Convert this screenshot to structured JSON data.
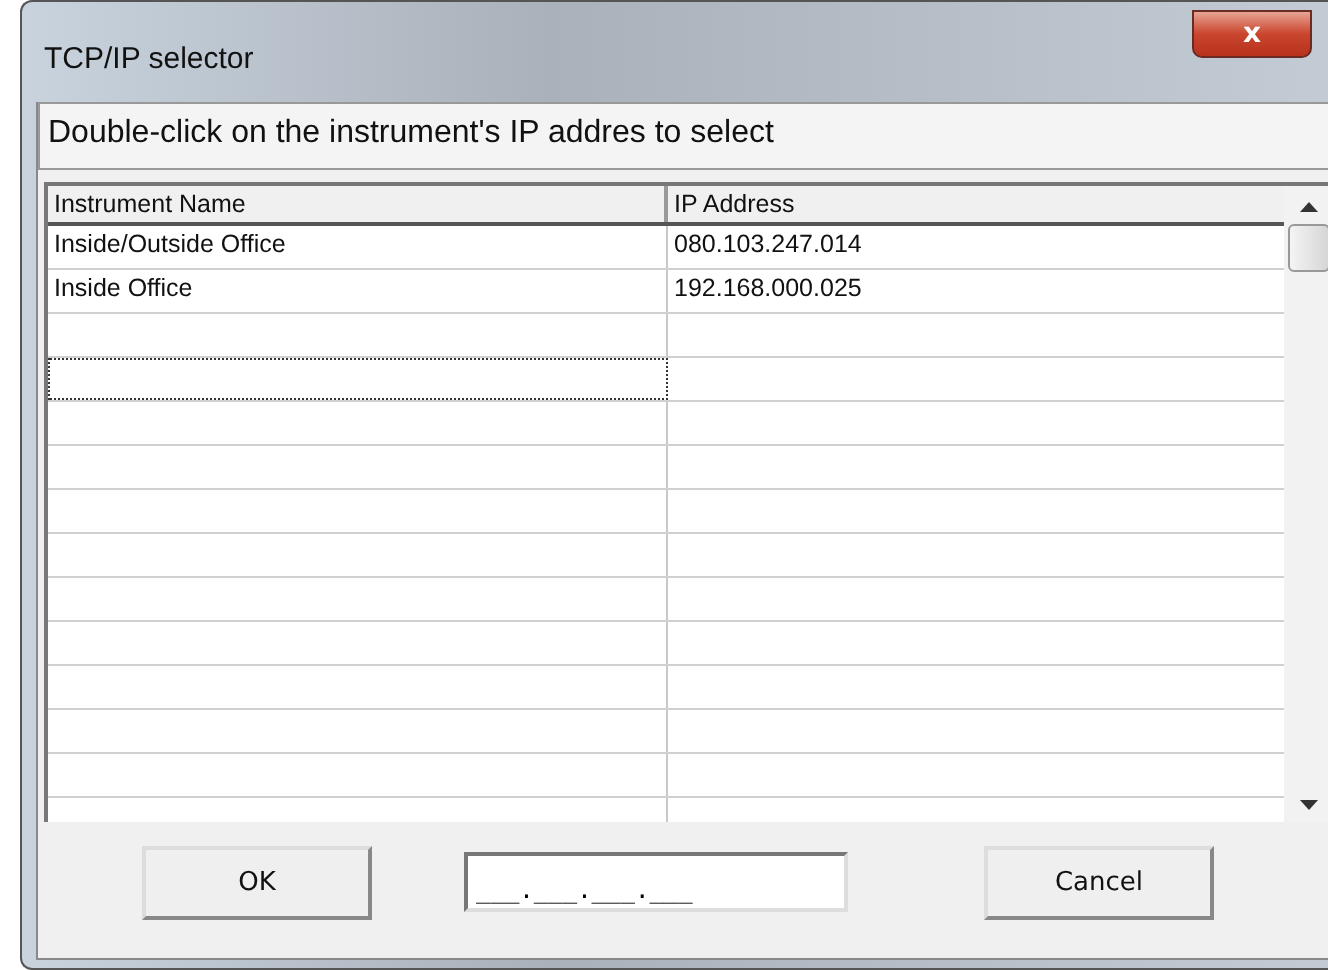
{
  "window": {
    "title": "TCP/IP selector",
    "close_button": "x"
  },
  "instruction": "Double-click on the instrument's IP  addres to select",
  "table": {
    "columns": [
      "Instrument Name",
      "IP Address"
    ],
    "rows": [
      {
        "name": "Inside/Outside Office",
        "ip": "080.103.247.014"
      },
      {
        "name": "Inside Office",
        "ip": "192.168.000.025"
      }
    ],
    "empty_rows": [
      {
        "focused": false
      },
      {
        "focused": true
      },
      {
        "focused": false
      },
      {
        "focused": false
      },
      {
        "focused": false
      },
      {
        "focused": false
      },
      {
        "focused": false
      },
      {
        "focused": false
      },
      {
        "focused": false
      },
      {
        "focused": false
      },
      {
        "focused": false
      },
      {
        "focused": false
      }
    ]
  },
  "buttons": {
    "ok": "OK",
    "cancel": "Cancel"
  },
  "ip_field": {
    "value": "___.___.___.___"
  }
}
